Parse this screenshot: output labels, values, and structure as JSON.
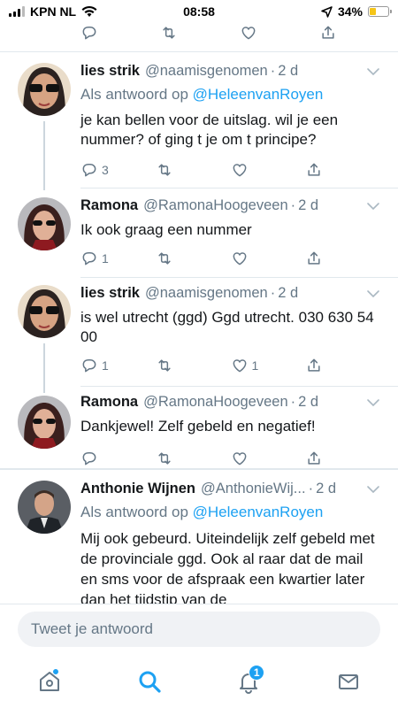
{
  "status_bar": {
    "carrier": "KPN NL",
    "time": "08:58",
    "battery": "34%"
  },
  "top_actions": {
    "reply_count": "",
    "like_count": ""
  },
  "tweets": [
    {
      "name": "lies strik",
      "handle": "@naamisgenomen",
      "time": "2 d",
      "reply_prefix": "Als antwoord op",
      "reply_to": "@HeleenvanRoyen",
      "text": "je kan bellen voor de uitslag. wil je een nummer? of ging t je om t principe?",
      "reply_count": "3",
      "like_count": ""
    },
    {
      "name": "Ramona",
      "handle": "@RamonaHoogeveen",
      "time": "2 d",
      "text": "Ik ook graag een nummer",
      "reply_count": "1",
      "like_count": ""
    },
    {
      "name": "lies strik",
      "handle": "@naamisgenomen",
      "time": "2 d",
      "text": "is wel utrecht (ggd) Ggd utrecht. 030 630 54 00",
      "reply_count": "1",
      "like_count": "1"
    },
    {
      "name": "Ramona",
      "handle": "@RamonaHoogeveen",
      "time": "2 d",
      "text": "Dankjewel! Zelf gebeld en negatief!",
      "reply_count": "",
      "like_count": ""
    },
    {
      "name": "Anthonie Wijnen",
      "handle": "@AnthonieWij...",
      "time": "2 d",
      "reply_prefix": "Als antwoord op",
      "reply_to": "@HeleenvanRoyen",
      "text": "Mij ook gebeurd. Uiteindelijk zelf gebeld met de provinciale ggd. Ook al raar dat de mail en sms voor de afspraak een kwartier later dan het tijdstip van de"
    }
  ],
  "reply_bar": {
    "placeholder": "Tweet je antwoord"
  },
  "tab_bar": {
    "notifications_badge": "1",
    "icons": [
      "home-icon",
      "search-icon",
      "bell-icon",
      "mail-icon"
    ]
  },
  "colors": {
    "accent": "#1da1f2",
    "text": "#14171a",
    "muted": "#657786",
    "divider": "#e1e8ed"
  }
}
